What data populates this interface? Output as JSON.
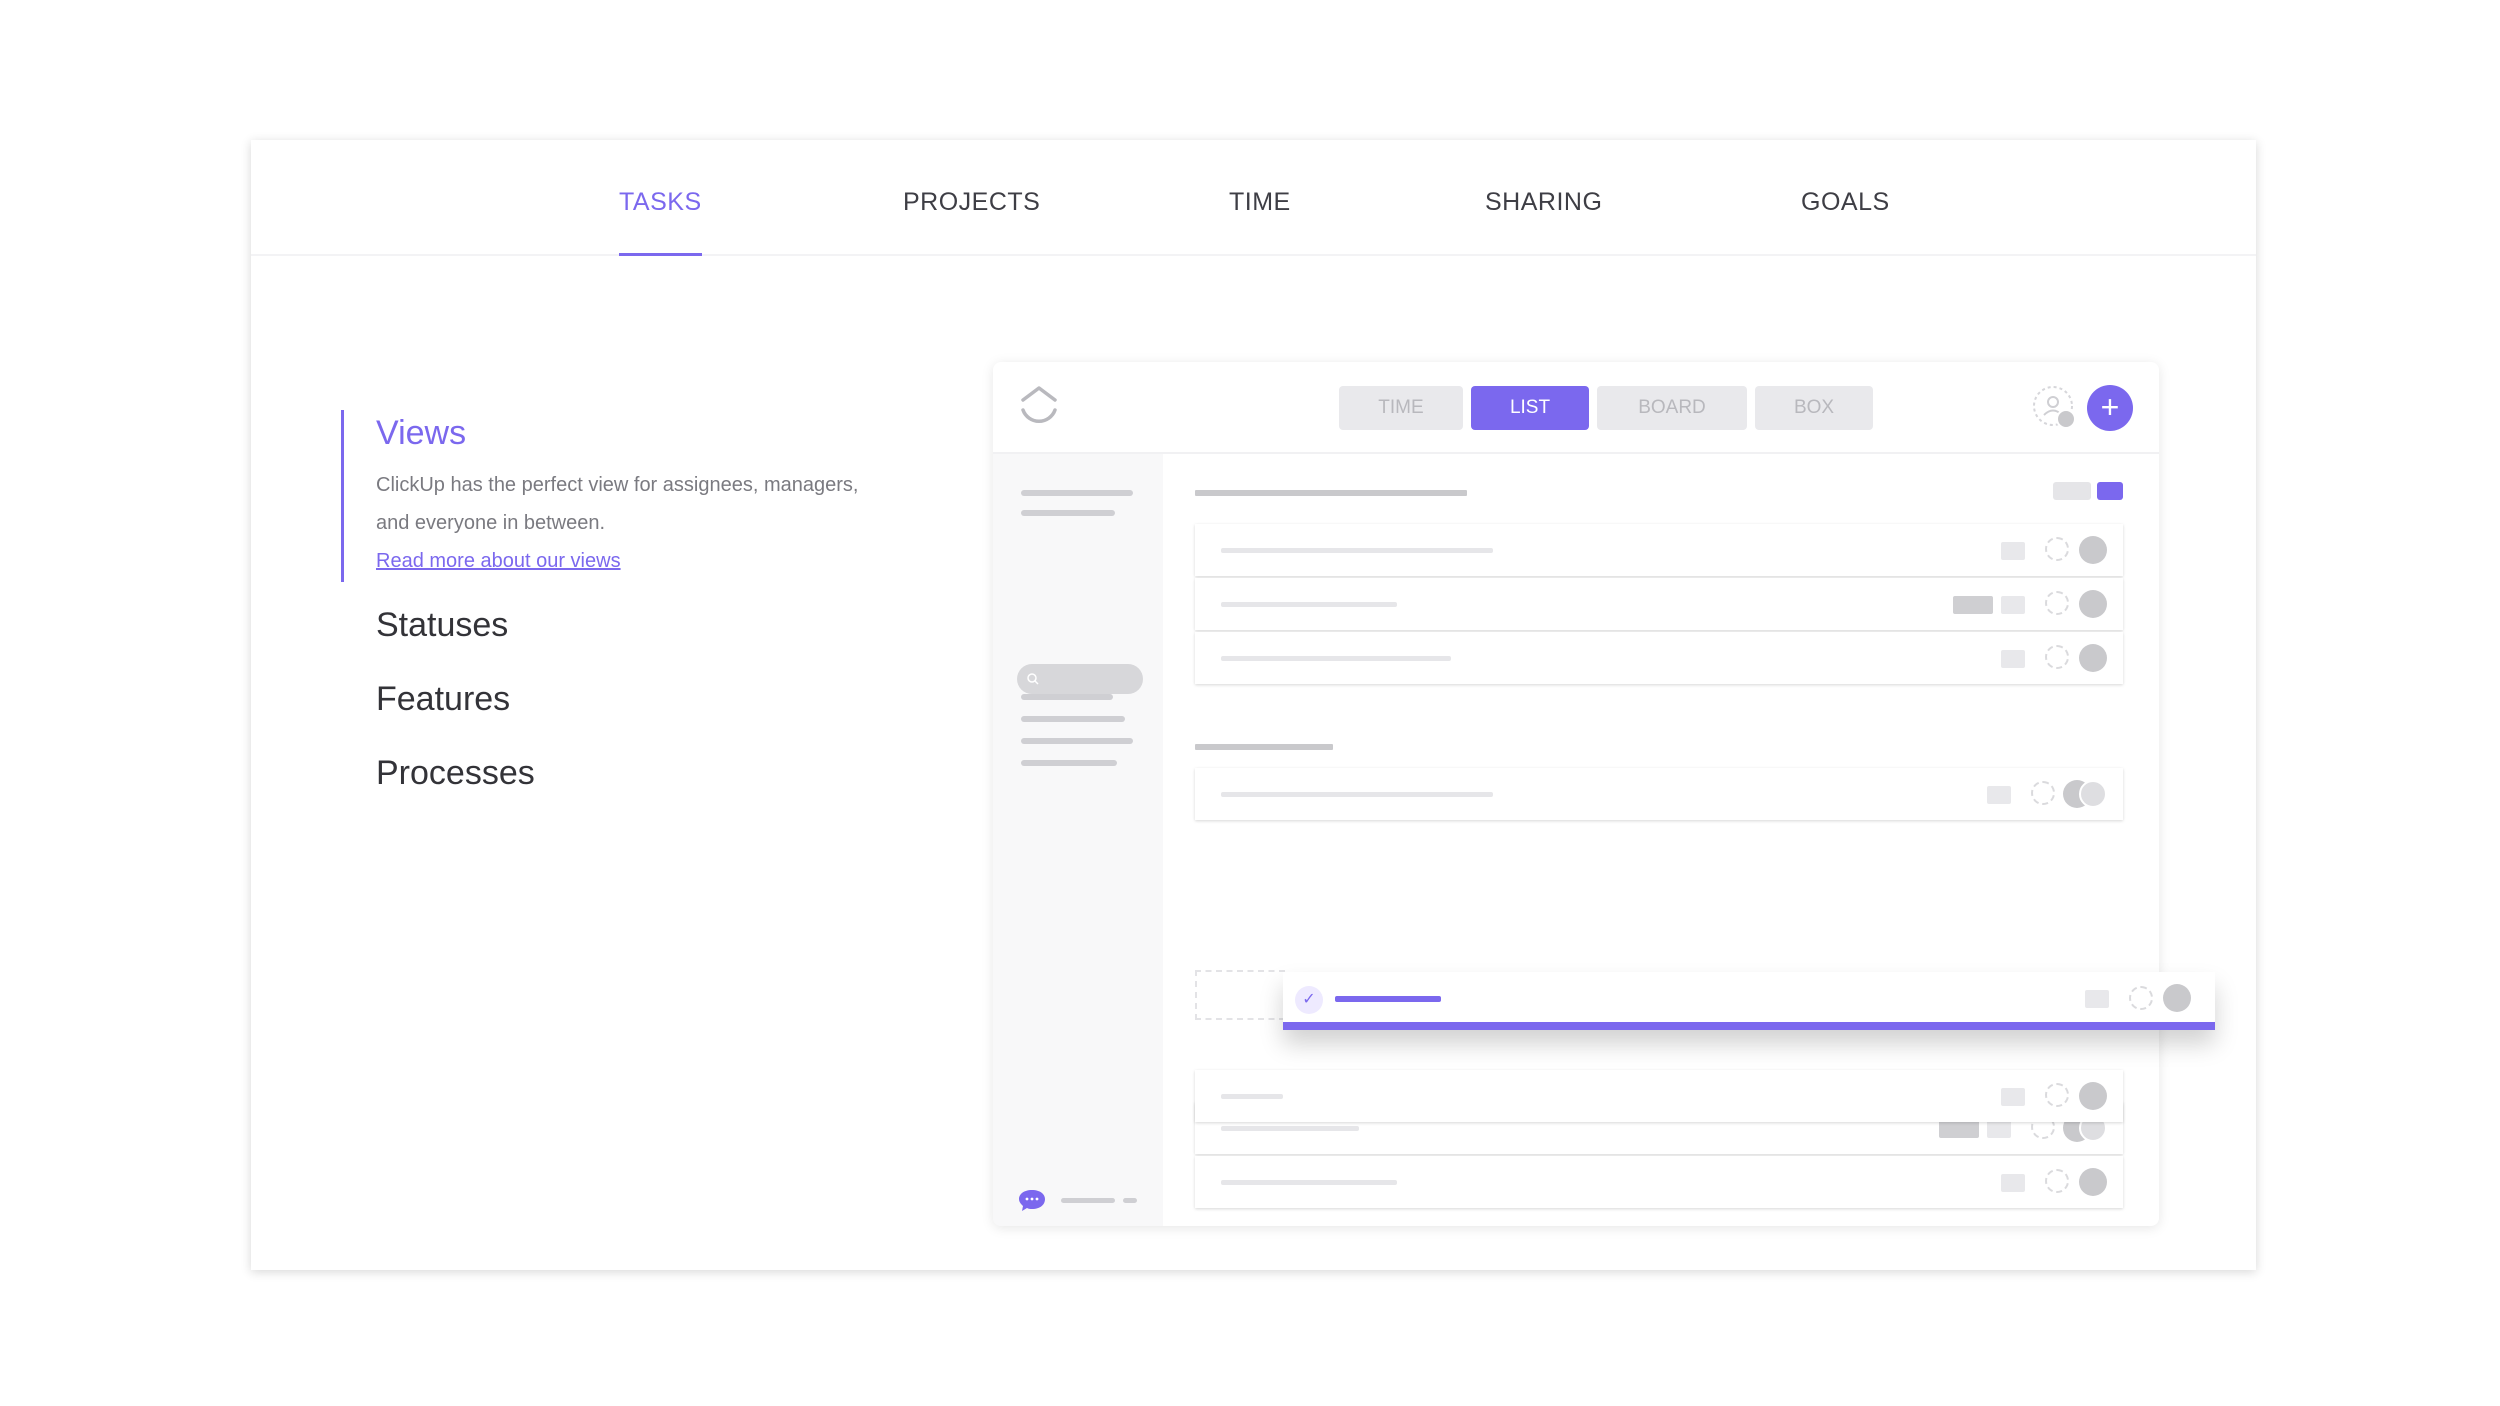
{
  "tabs": [
    {
      "label": "TASKS",
      "active": true
    },
    {
      "label": "PROJECTS",
      "active": false
    },
    {
      "label": "TIME",
      "active": false
    },
    {
      "label": "SHARING",
      "active": false
    },
    {
      "label": "GOALS",
      "active": false
    }
  ],
  "features": {
    "active": {
      "title": "Views",
      "description_line1": "ClickUp has the perfect view for assignees, managers,",
      "description_line2": "and everyone in between.",
      "link": "Read more about our views"
    },
    "items": [
      "Statuses",
      "Features",
      "Processes"
    ]
  },
  "app": {
    "view_buttons": [
      {
        "label": "TIME",
        "active": false
      },
      {
        "label": "LIST",
        "active": true
      },
      {
        "label": "BOARD",
        "active": false
      },
      {
        "label": "BOX",
        "active": false
      }
    ],
    "plus_symbol": "+",
    "check_symbol": "✓",
    "icons": [
      "clickup-logo-icon",
      "user-add-icon",
      "plus-icon",
      "search-icon",
      "chat-icon",
      "check-icon"
    ]
  },
  "colors": {
    "accent": "#7b68ee",
    "text": "#333338",
    "muted": "#7a7a80"
  }
}
